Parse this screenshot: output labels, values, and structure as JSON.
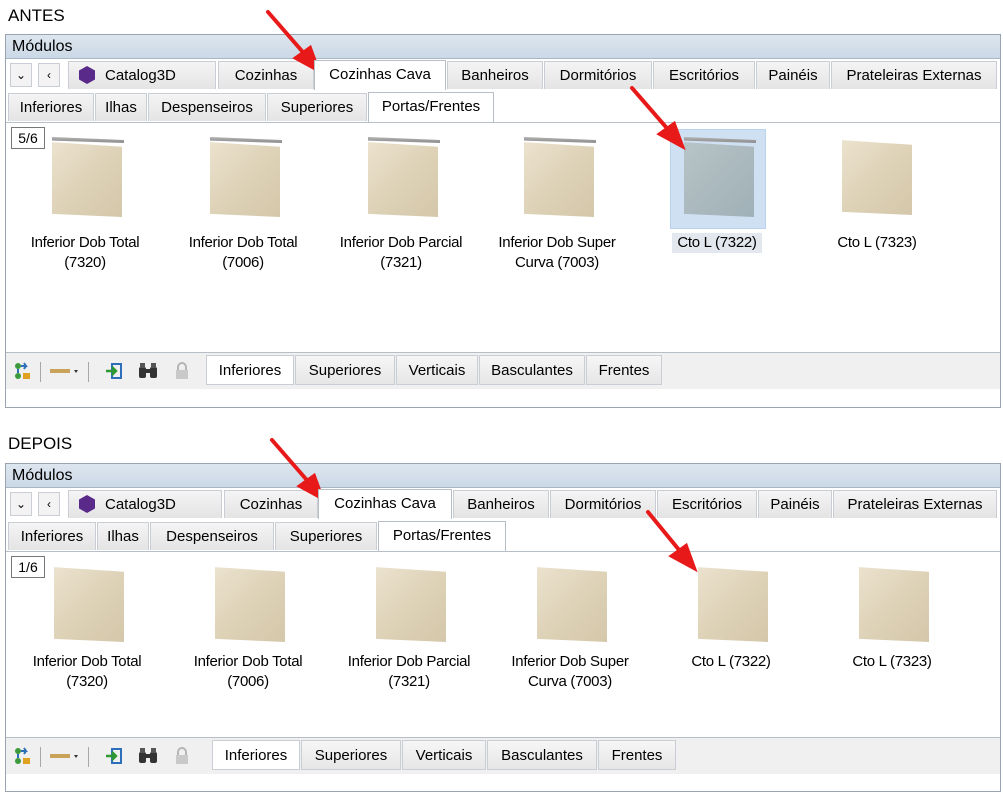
{
  "panels": [
    {
      "caption": "ANTES",
      "title": "Módulos",
      "nav": {
        "dropdown_glyph": "⌄",
        "back_glyph": "‹"
      },
      "catalog_label": "Catalog3D",
      "tabs": [
        "Cozinhas",
        "Cozinhas Cava",
        "Banheiros",
        "Dormitórios",
        "Escritórios",
        "Painéis",
        "Prateleiras Externas"
      ],
      "subtabs": [
        "Inferiores",
        "Ilhas",
        "Despenseiros",
        "Superiores",
        "Portas/Frentes"
      ],
      "page_indicator": "5/6",
      "items": [
        {
          "line1": "Inferior Dob Total",
          "line2": "(7320)"
        },
        {
          "line1": "Inferior Dob Total",
          "line2": "(7006)"
        },
        {
          "line1": "Inferior Dob Parcial",
          "line2": "(7321)"
        },
        {
          "line1": "Inferior Dob Super",
          "line2": "Curva (7003)"
        },
        {
          "line1": "Cto L (7322)",
          "line2": ""
        },
        {
          "line1": "Cto L (7323)",
          "line2": ""
        }
      ],
      "bottom_tabs": [
        "Inferiores",
        "Superiores",
        "Verticais",
        "Basculantes",
        "Frentes"
      ]
    },
    {
      "caption": "DEPOIS",
      "title": "Módulos",
      "nav": {
        "dropdown_glyph": "⌄",
        "back_glyph": "‹"
      },
      "catalog_label": "Catalog3D",
      "tabs": [
        "Cozinhas",
        "Cozinhas Cava",
        "Banheiros",
        "Dormitórios",
        "Escritórios",
        "Painéis",
        "Prateleiras Externas"
      ],
      "subtabs": [
        "Inferiores",
        "Ilhas",
        "Despenseiros",
        "Superiores",
        "Portas/Frentes"
      ],
      "page_indicator": "1/6",
      "items": [
        {
          "line1": "Inferior Dob Total",
          "line2": "(7320)"
        },
        {
          "line1": "Inferior Dob Total",
          "line2": "(7006)"
        },
        {
          "line1": "Inferior Dob Parcial",
          "line2": "(7321)"
        },
        {
          "line1": "Inferior Dob Super",
          "line2": "Curva (7003)"
        },
        {
          "line1": "Cto L (7322)",
          "line2": ""
        },
        {
          "line1": "Cto L (7323)",
          "line2": ""
        }
      ],
      "bottom_tabs": [
        "Inferiores",
        "Superiores",
        "Verticais",
        "Basculantes",
        "Frentes"
      ]
    }
  ],
  "toolbar_icons": [
    "tree-refresh-icon",
    "line-dropdown-icon",
    "import-arrow-icon",
    "binoculars-icon",
    "lock-icon"
  ],
  "toolbar_glyphs": {
    "binoculars": "👓"
  },
  "colors": {
    "arrow": "#e81919",
    "selection": "#cfe0f3",
    "titlebar": "#cbd8e6"
  }
}
